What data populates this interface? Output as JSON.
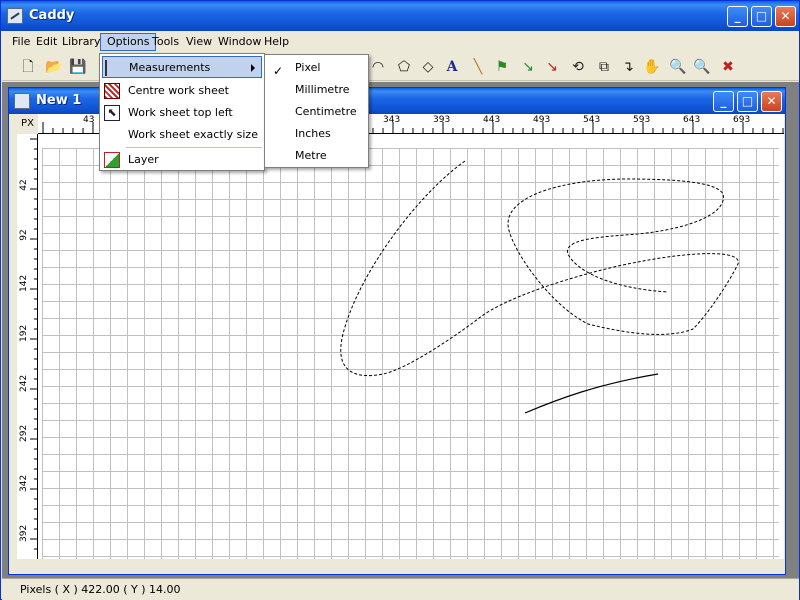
{
  "window": {
    "title": "Caddy"
  },
  "menubar": {
    "items": [
      "File",
      "Edit",
      "Library",
      "Options",
      "Tools",
      "View",
      "Window",
      "Help"
    ]
  },
  "child": {
    "title": "New 1"
  },
  "ruler": {
    "unit": "PX",
    "h_labels": [
      "43",
      "343",
      "393",
      "443",
      "493",
      "543",
      "593",
      "643",
      "693"
    ],
    "v_labels": [
      "42",
      "92",
      "142",
      "192",
      "242",
      "292",
      "342",
      "392"
    ]
  },
  "options_menu": {
    "items": [
      "Measurements",
      "Centre work sheet",
      "Work sheet top left",
      "Work sheet exactly size",
      "Layer"
    ]
  },
  "measurements_menu": {
    "items": [
      "Pixel",
      "Millimetre",
      "Centimetre",
      "Inches",
      "Metre"
    ],
    "selected": "Pixel"
  },
  "status": {
    "text": "Pixels ( X ) 422.00    ( Y ) 14.00"
  }
}
